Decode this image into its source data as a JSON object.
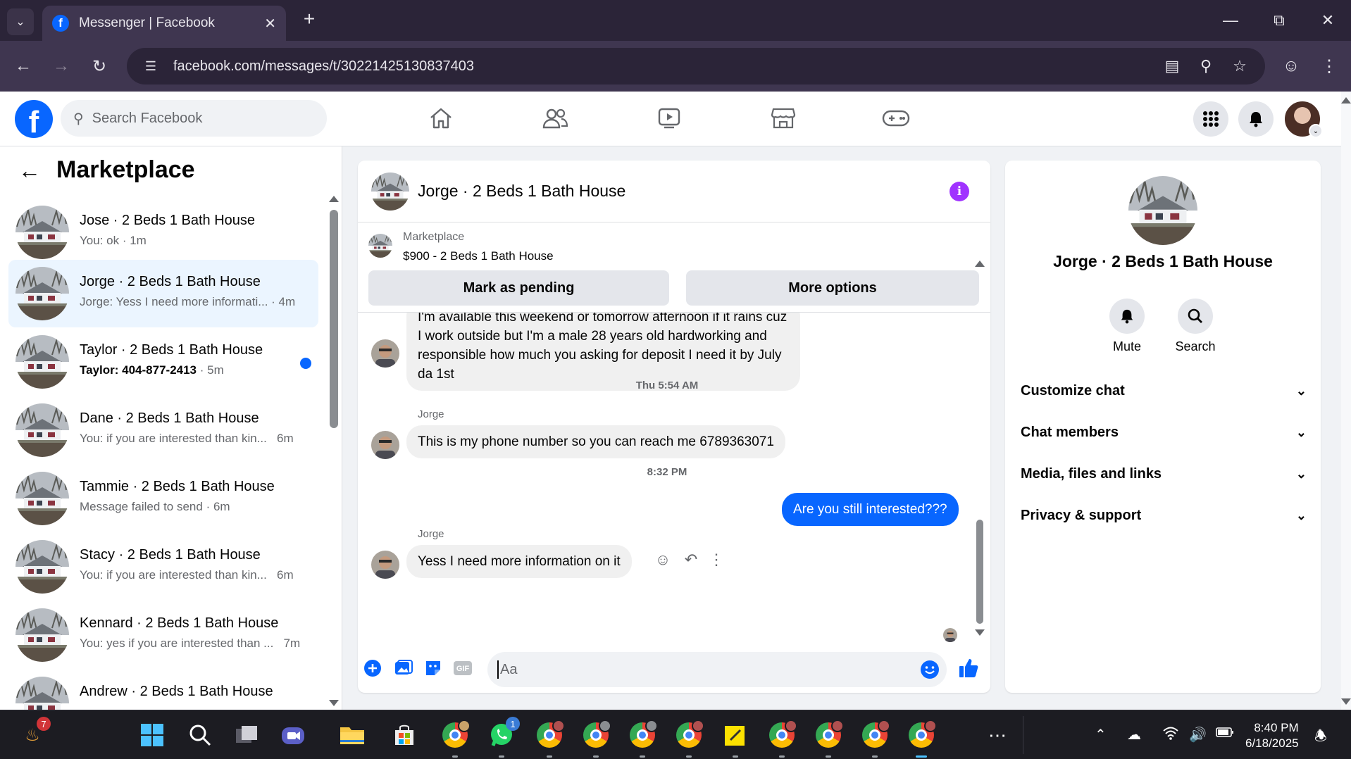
{
  "browser": {
    "tab_title": "Messenger | Facebook",
    "url": "facebook.com/messages/t/30221425130837403"
  },
  "facebook": {
    "search_placeholder": "Search Facebook"
  },
  "sidebar": {
    "title": "Marketplace",
    "conversations": [
      {
        "name": "Jose · 2 Beds 1 Bath House",
        "preview": "You: ok",
        "time": "1m",
        "active": false,
        "unread": false
      },
      {
        "name": "Jorge · 2 Beds 1 Bath House",
        "preview": "Jorge: Yess I need more informati...",
        "time": "4m",
        "active": true,
        "unread": false
      },
      {
        "name": "Taylor · 2 Beds 1 Bath House",
        "preview": "Taylor: 404-877-2413",
        "time": "5m",
        "active": false,
        "unread": true
      },
      {
        "name": "Dane · 2 Beds 1 Bath House",
        "preview": "You: if you are interested than kin...",
        "time": "6m",
        "active": false,
        "unread": false
      },
      {
        "name": "Tammie · 2 Beds 1 Bath House",
        "preview": "Message failed to send",
        "time": "6m",
        "active": false,
        "unread": false
      },
      {
        "name": "Stacy · 2 Beds 1 Bath House",
        "preview": "You: if you are interested than kin...",
        "time": "6m",
        "active": false,
        "unread": false
      },
      {
        "name": "Kennard · 2 Beds 1 Bath House",
        "preview": "You: yes if you are interested than ...",
        "time": "7m",
        "active": false,
        "unread": false
      },
      {
        "name": "Andrew · 2 Beds 1 Bath House",
        "preview": "",
        "time": "",
        "active": false,
        "unread": false
      }
    ]
  },
  "chat": {
    "title": "Jorge · 2 Beds 1 Bath House",
    "marketplace_label": "Marketplace",
    "listing": "$900 - 2 Beds 1 Bath House",
    "mark_pending": "Mark as pending",
    "more_options": "More options",
    "messages": {
      "m1": "I'm available this weekend or tomorrow afternoon if it rains cuz I work outside but I'm a male 28 years old hardworking and responsible how much you asking for deposit I need it by July da 1st",
      "ts1": "Thu 5:54 AM",
      "sender2": "Jorge",
      "m2": "This is my phone number so you can reach me 6789363071",
      "ts2": "8:32 PM",
      "m3": "Are you still interested???",
      "sender4": "Jorge",
      "m4": "Yess I need more information on it"
    },
    "composer_placeholder": "Aa"
  },
  "info_panel": {
    "name": "Jorge · 2 Beds 1 Bath House",
    "mute": "Mute",
    "search": "Search",
    "rows": [
      "Customize chat",
      "Chat members",
      "Media, files and links",
      "Privacy & support"
    ]
  },
  "taskbar": {
    "widgets_badge": "7",
    "whatsapp_badge": "1",
    "time": "8:40 PM",
    "date": "6/18/2025"
  },
  "colors": {
    "fb_blue": "#0866ff",
    "info_purple": "#a033ff",
    "browser_dark": "#2b2438"
  }
}
